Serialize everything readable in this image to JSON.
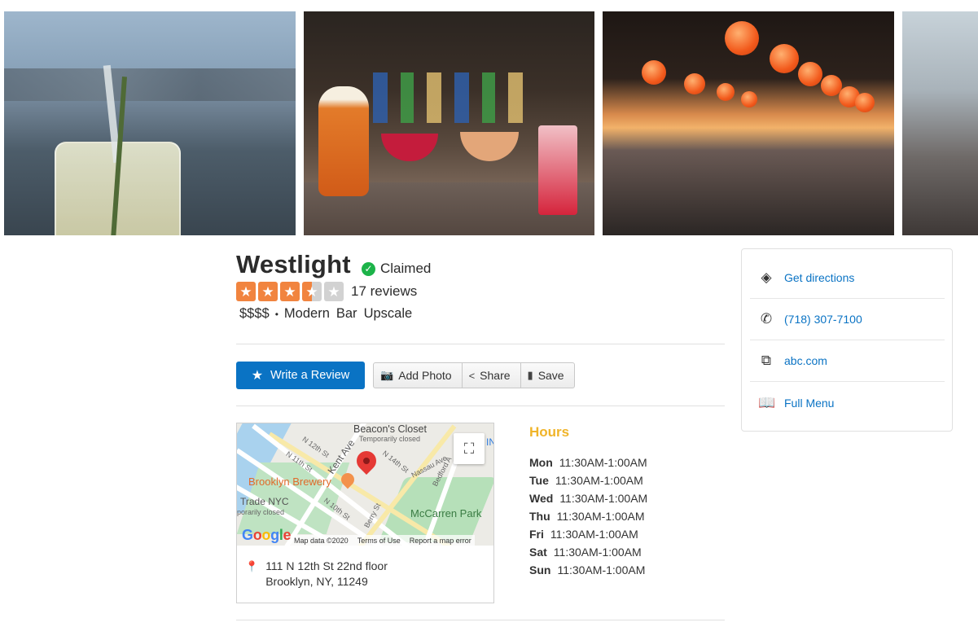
{
  "photos": [
    {
      "alt": "cocktail-with-herb-sprig"
    },
    {
      "alt": "beer-and-cocktails-at-bar"
    },
    {
      "alt": "rooftop-dining-room-with-lanterns"
    },
    {
      "alt": "diners-by-window"
    }
  ],
  "business": {
    "name": "Westlight",
    "claimed_label": "Claimed",
    "rating": 3.5,
    "max_rating": 5,
    "reviews": "17 reviews",
    "price": "$$$$",
    "categories": [
      "Modern",
      "Bar",
      "Upscale"
    ]
  },
  "actions": {
    "write_review": "Write a Review",
    "add_photo": "Add Photo",
    "share": "Share",
    "save": "Save"
  },
  "map": {
    "labels": {
      "beacons_closet": "Beacon's Closet",
      "temporarily_closed": "Temporarily closed",
      "brooklyn_brewery": "Brooklyn Brewery",
      "trade_nyc": "Trade NYC",
      "trade_closed": "porarily closed",
      "mccarren_park": "McCarren Park",
      "kent_ave": "Kent Ave",
      "n12": "N 12th St",
      "n11": "N 11th St",
      "n14": "N 14th St",
      "n10": "N 10th St",
      "nassau": "Nassau Ave",
      "bedford": "Bedford A",
      "berry": "Berry St",
      "cut_ln": "IN"
    },
    "footer": {
      "map_data": "Map data ©2020",
      "terms": "Terms of Use",
      "report": "Report a map error"
    },
    "google_letters": [
      "G",
      "o",
      "o",
      "g",
      "l",
      "e"
    ]
  },
  "address": {
    "line1": "111 N 12th St 22nd floor",
    "line2": "Brooklyn, NY, 11249"
  },
  "hours": {
    "title": "Hours",
    "days": [
      {
        "day": "Mon",
        "time": "11:30AM-1:00AM"
      },
      {
        "day": "Tue",
        "time": "11:30AM-1:00AM"
      },
      {
        "day": "Wed",
        "time": "11:30AM-1:00AM"
      },
      {
        "day": "Thu",
        "time": "11:30AM-1:00AM"
      },
      {
        "day": "Fri",
        "time": "11:30AM-1:00AM"
      },
      {
        "day": "Sat",
        "time": "11:30AM-1:00AM"
      },
      {
        "day": "Sun",
        "time": "11:30AM-1:00AM"
      }
    ]
  },
  "sidebar": {
    "items": [
      {
        "label": "Get directions",
        "icon": "directions-icon"
      },
      {
        "label": "(718) 307-7100",
        "icon": "phone-icon"
      },
      {
        "label": "abc.com",
        "icon": "external-link-icon"
      },
      {
        "label": "Full Menu",
        "icon": "menu-book-icon"
      }
    ]
  },
  "colors": {
    "brand_blue": "#0a73c4",
    "star_orange": "#f1843f",
    "claimed_green": "#1cb349",
    "hours_gold": "#f0b429"
  }
}
